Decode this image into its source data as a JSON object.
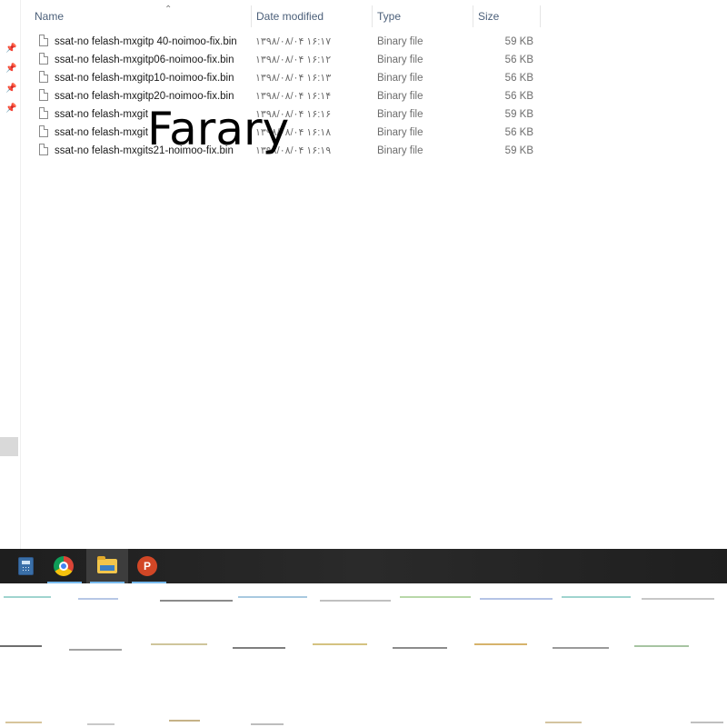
{
  "header": {
    "name": "Name",
    "date_modified": "Date modified",
    "type": "Type",
    "size": "Size"
  },
  "files": [
    {
      "name": "ssat-no felash-mxgitp 40-noimoo-fix.bin",
      "date": "۱۳۹۸/۰۸/۰۴ ۱۶:۱۷",
      "type": "Binary file",
      "size": "59 KB"
    },
    {
      "name": "ssat-no felash-mxgitp06-noimoo-fix.bin",
      "date": "۱۳۹۸/۰۸/۰۴ ۱۶:۱۲",
      "type": "Binary file",
      "size": "56 KB"
    },
    {
      "name": "ssat-no felash-mxgitp10-noimoo-fix.bin",
      "date": "۱۳۹۸/۰۸/۰۴ ۱۶:۱۳",
      "type": "Binary file",
      "size": "56 KB"
    },
    {
      "name": "ssat-no felash-mxgitp20-noimoo-fix.bin",
      "date": "۱۳۹۸/۰۸/۰۴ ۱۶:۱۴",
      "type": "Binary file",
      "size": "56 KB"
    },
    {
      "name": "ssat-no felash-mxgit",
      "date": "۱۳۹۸/۰۸/۰۴ ۱۶:۱۶",
      "type": "Binary file",
      "size": "59 KB"
    },
    {
      "name": "ssat-no felash-mxgit",
      "date": "۱۳۹۸/۰۸/۰۴ ۱۶:۱۸",
      "type": "Binary file",
      "size": "56 KB"
    },
    {
      "name": "ssat-no felash-mxgits21-noimoo-fix.bin",
      "date": "۱۳۹۸/۰۸/۰۴ ۱۶:۱۹",
      "type": "Binary file",
      "size": "59 KB"
    }
  ],
  "watermark": "Farary",
  "icons": {
    "pin": "pin-icon",
    "file": "file-icon",
    "sort": "sort-ascending-icon",
    "calculator": "calculator-icon",
    "chrome": "chrome-icon",
    "explorer": "folder-icon",
    "powerpoint": "powerpoint-icon"
  },
  "taskbar": {
    "ppt_letter": "P"
  },
  "colors": {
    "header_text": "#4c607a",
    "taskbar_bg": "#2a2a2a",
    "active_underline": "#76b9ed"
  }
}
